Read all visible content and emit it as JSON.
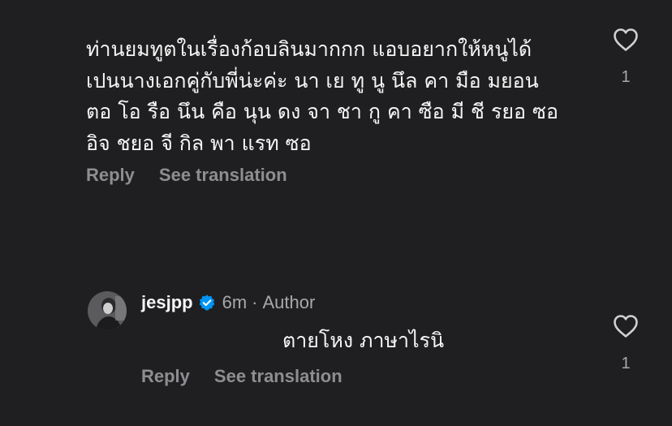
{
  "comment": {
    "lines": [
      "ท่านยมทูตในเรื่องก้อบลินมากกก แอบอยากให้หนูได้",
      "เปนนางเอกคู่กับพี่น่ะค่ะ นา เย ทู นู นึล คา มือ มยอน",
      "ตอ โอ รือ นึน คือ นุน ดง จา ชา กู คา ซือ มี ชี รยอ ซอ",
      "อิจ ชยอ จี กิล พา แรท ซอ"
    ],
    "reply_label": "Reply",
    "translate_label": "See translation",
    "like_count": "1",
    "icon": "heart-outline"
  },
  "reply": {
    "username": "jesjpp",
    "verified_icon": "verified-badge",
    "verified_color": "#0095f6",
    "time": "6m",
    "separator": "·",
    "role": "Author",
    "text": "ตายโหง ภาษาไรนิ",
    "reply_label": "Reply",
    "translate_label": "See translation",
    "like_count": "1",
    "icon": "heart-outline"
  },
  "theme": {
    "background": "#1f1f21",
    "text": "#f5f5f5",
    "muted": "#8e8e92"
  }
}
